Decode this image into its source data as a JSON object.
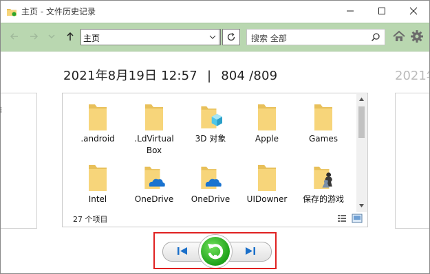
{
  "window": {
    "title": "主页 - 文件历史记录"
  },
  "toolbar": {
    "address_value": "主页",
    "search_placeholder": "搜索 全部"
  },
  "snapshot": {
    "date_time": "2021年8月19日 12:57",
    "separator": "|",
    "counter": "804 /809",
    "next_title_partial": "2021年"
  },
  "items": [
    {
      "label": ".android",
      "icon": "folder-icon"
    },
    {
      "label": ".LdVirtual Box",
      "icon": "folder-icon"
    },
    {
      "label": "3D 对象",
      "icon": "folder-3d-icon"
    },
    {
      "label": "Apple",
      "icon": "folder-icon"
    },
    {
      "label": "Games",
      "icon": "folder-icon"
    },
    {
      "label": "Intel",
      "icon": "folder-icon"
    },
    {
      "label": "OneDrive",
      "icon": "folder-onedrive-icon"
    },
    {
      "label": "OneDrive",
      "icon": "folder-onedrive-icon"
    },
    {
      "label": "UIDowner",
      "icon": "folder-icon"
    },
    {
      "label": "保存的游戏",
      "icon": "folder-games-icon"
    }
  ],
  "status": {
    "item_count": "27 个项目"
  },
  "colors": {
    "toolbar_bg": "#b9d7b0",
    "folder": "#f7d57a",
    "restore_green": "#1ea21a",
    "nav_blue": "#1a6fc9",
    "highlight_red": "#e02020"
  }
}
